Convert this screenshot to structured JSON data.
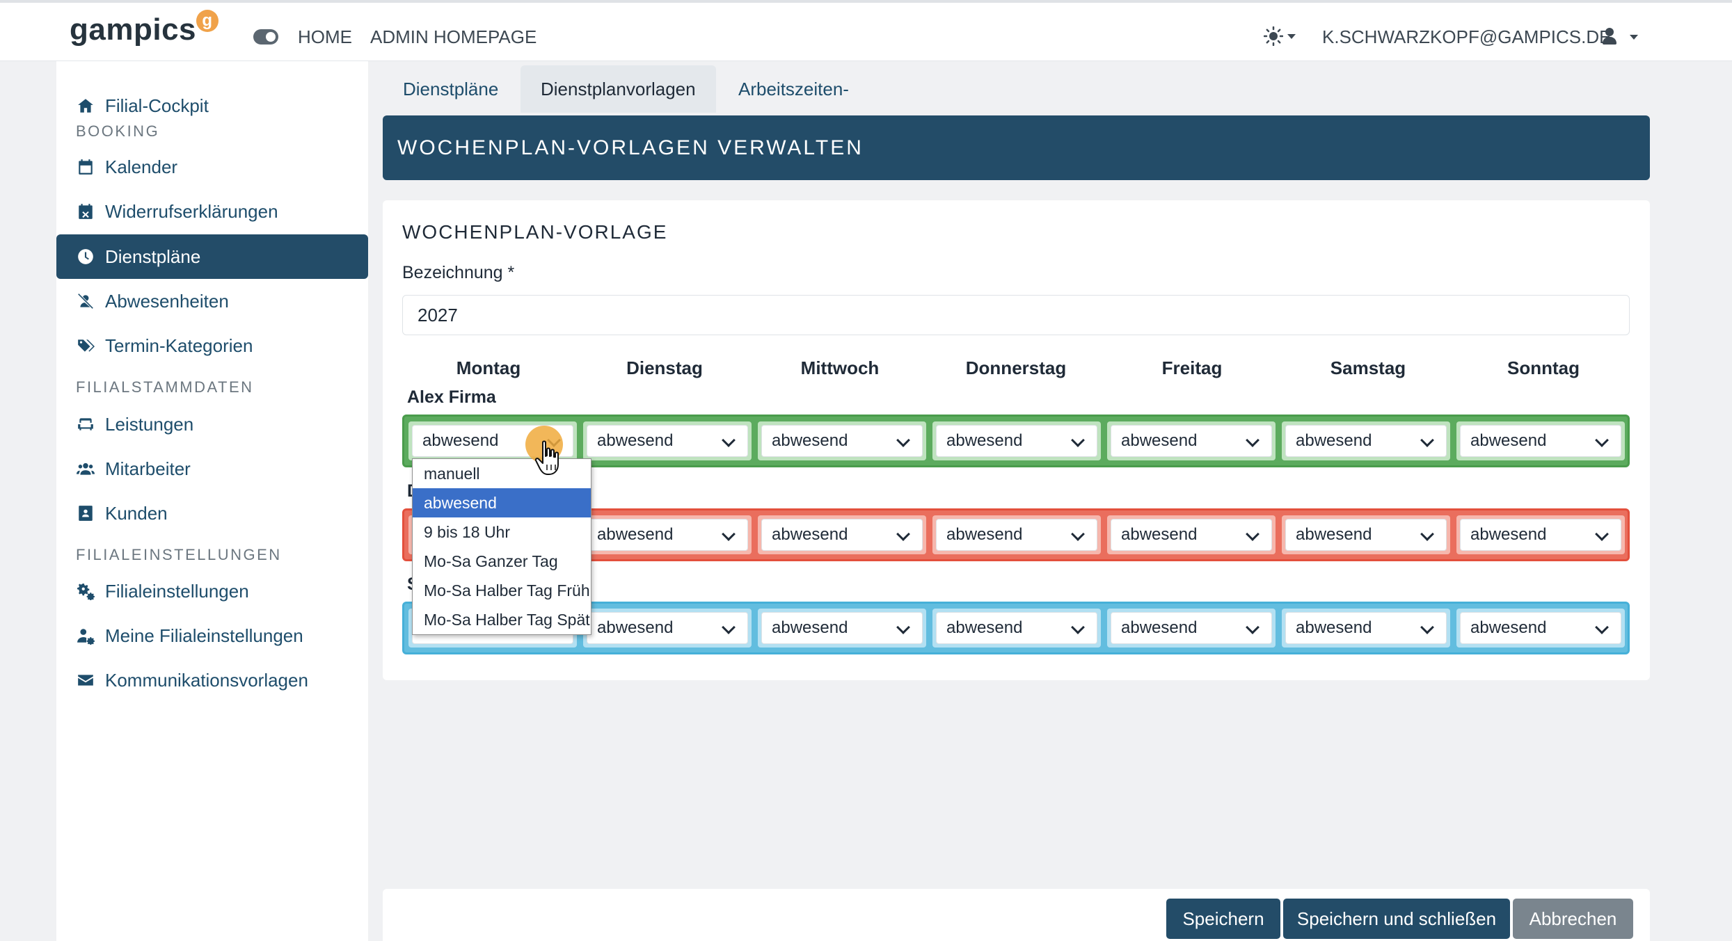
{
  "topbar": {
    "logo": "gampics",
    "logo_badge": "g",
    "nav": [
      "HOME",
      "ADMIN HOMEPAGE"
    ],
    "theme_icon": "sun-icon",
    "user_email": "K.SCHWARZKOPF@GAMPICS.DE"
  },
  "sidebar": {
    "items": [
      {
        "label": "Filial-Cockpit",
        "icon": "home-icon"
      },
      {
        "section": "BOOKING"
      },
      {
        "label": "Kalender",
        "icon": "calendar-icon"
      },
      {
        "label": "Widerrufserklärungen",
        "icon": "calendar-x-icon"
      },
      {
        "label": "Dienstpläne",
        "icon": "clock-icon",
        "active": true
      },
      {
        "label": "Abwesenheiten",
        "icon": "user-slash-icon"
      },
      {
        "label": "Termin-Kategorien",
        "icon": "tags-icon"
      },
      {
        "section": "FILIALSTAMMDATEN"
      },
      {
        "label": "Leistungen",
        "icon": "couch-icon"
      },
      {
        "label": "Mitarbeiter",
        "icon": "users-icon"
      },
      {
        "label": "Kunden",
        "icon": "address-card-icon"
      },
      {
        "section": "FILIALEINSTELLUNGEN"
      },
      {
        "label": "Filialeinstellungen",
        "icon": "gears-icon"
      },
      {
        "label": "Meine Filialeinstellungen",
        "icon": "user-gear-icon"
      },
      {
        "label": "Kommunikationsvorlagen",
        "icon": "envelope-icon"
      }
    ]
  },
  "tabs": [
    "Dienstpläne",
    "Dienstplanvorlagen",
    "Arbeitszeiten-Vorlagen"
  ],
  "active_tab": "Dienstplanvorlagen",
  "page_title": "WOCHENPLAN-VORLAGEN VERWALTEN",
  "form": {
    "card_title": "WOCHENPLAN-VORLAGE",
    "bezeichnung_label": "Bezeichnung *",
    "bezeichnung_value": "2027"
  },
  "days": [
    "Montag",
    "Dienstag",
    "Mittwoch",
    "Donnerstag",
    "Freitag",
    "Samstag",
    "Sonntag"
  ],
  "employees": [
    {
      "name": "Alex Firma",
      "color": "#5cab5e",
      "values": [
        "abwesend",
        "abwesend",
        "abwesend",
        "abwesend",
        "abwesend",
        "abwesend",
        "abwesend"
      ]
    },
    {
      "name_partial": "D",
      "color": "#ea6e5d",
      "values": [
        "abwesend",
        "abwesend",
        "abwesend",
        "abwesend",
        "abwesend",
        "abwesend",
        "abwesend"
      ]
    },
    {
      "name_partial": "S",
      "color": "#62bddf",
      "values": [
        "abwesend",
        "abwesend",
        "abwesend",
        "abwesend",
        "abwesend",
        "abwesend",
        "abwesend"
      ]
    }
  ],
  "dropdown": {
    "options": [
      "manuell",
      "abwesend",
      "9 bis 18 Uhr",
      "Mo-Sa Ganzer Tag",
      "Mo-Sa Halber Tag Früh",
      "Mo-Sa Halber Tag Spät"
    ],
    "selected": "abwesend"
  },
  "buttons": {
    "save": "Speichern",
    "save_close": "Speichern und schließen",
    "cancel": "Abbrechen"
  }
}
